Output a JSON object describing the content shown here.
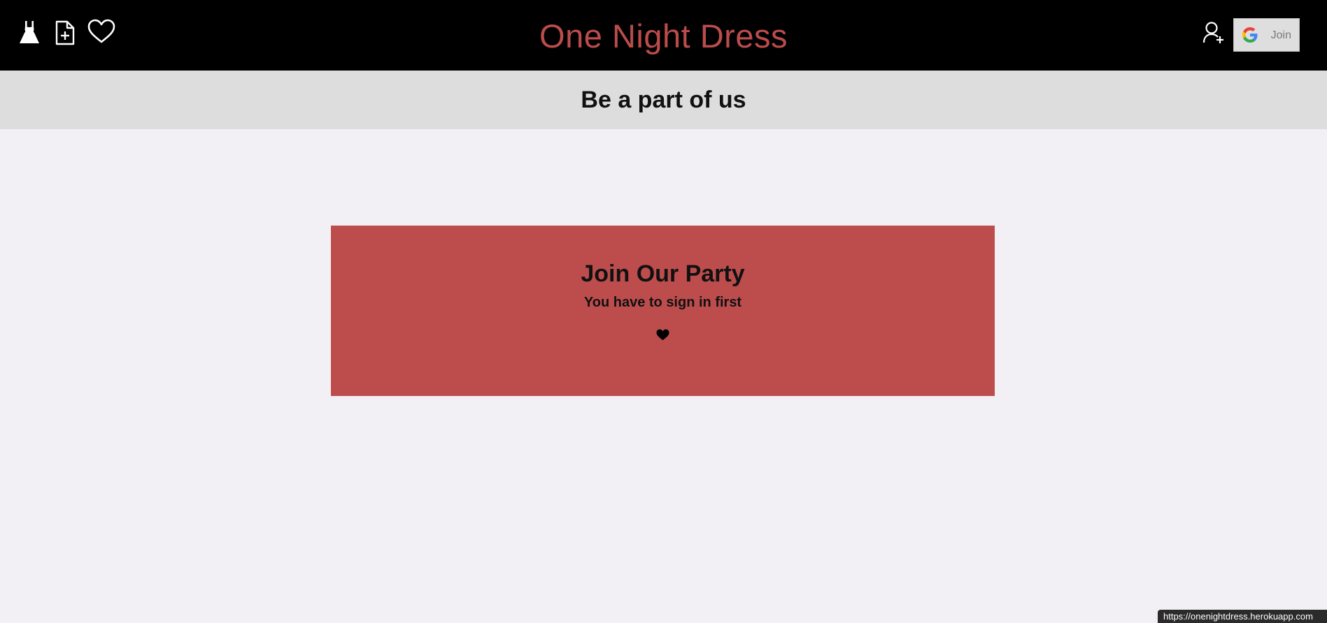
{
  "header": {
    "brand": "One Night Dress",
    "brand_color": "#bb4c4c",
    "background": "#000000",
    "nav_icons": [
      "dress-icon",
      "add-document-icon",
      "heart-icon"
    ],
    "account_icon": "add-user-icon",
    "google_join": {
      "icon": "google-g-icon",
      "label": "Join"
    }
  },
  "subheader": {
    "title": "Be a part of us",
    "background": "#dddddd"
  },
  "card": {
    "title": "Join Our Party",
    "subtitle": "You have to sign in first",
    "icon": "heart-icon",
    "background": "#bd4d4d"
  },
  "status_bar": {
    "url": "https://onenightdress.herokuapp.com"
  },
  "page_background": "#f2f0f5"
}
